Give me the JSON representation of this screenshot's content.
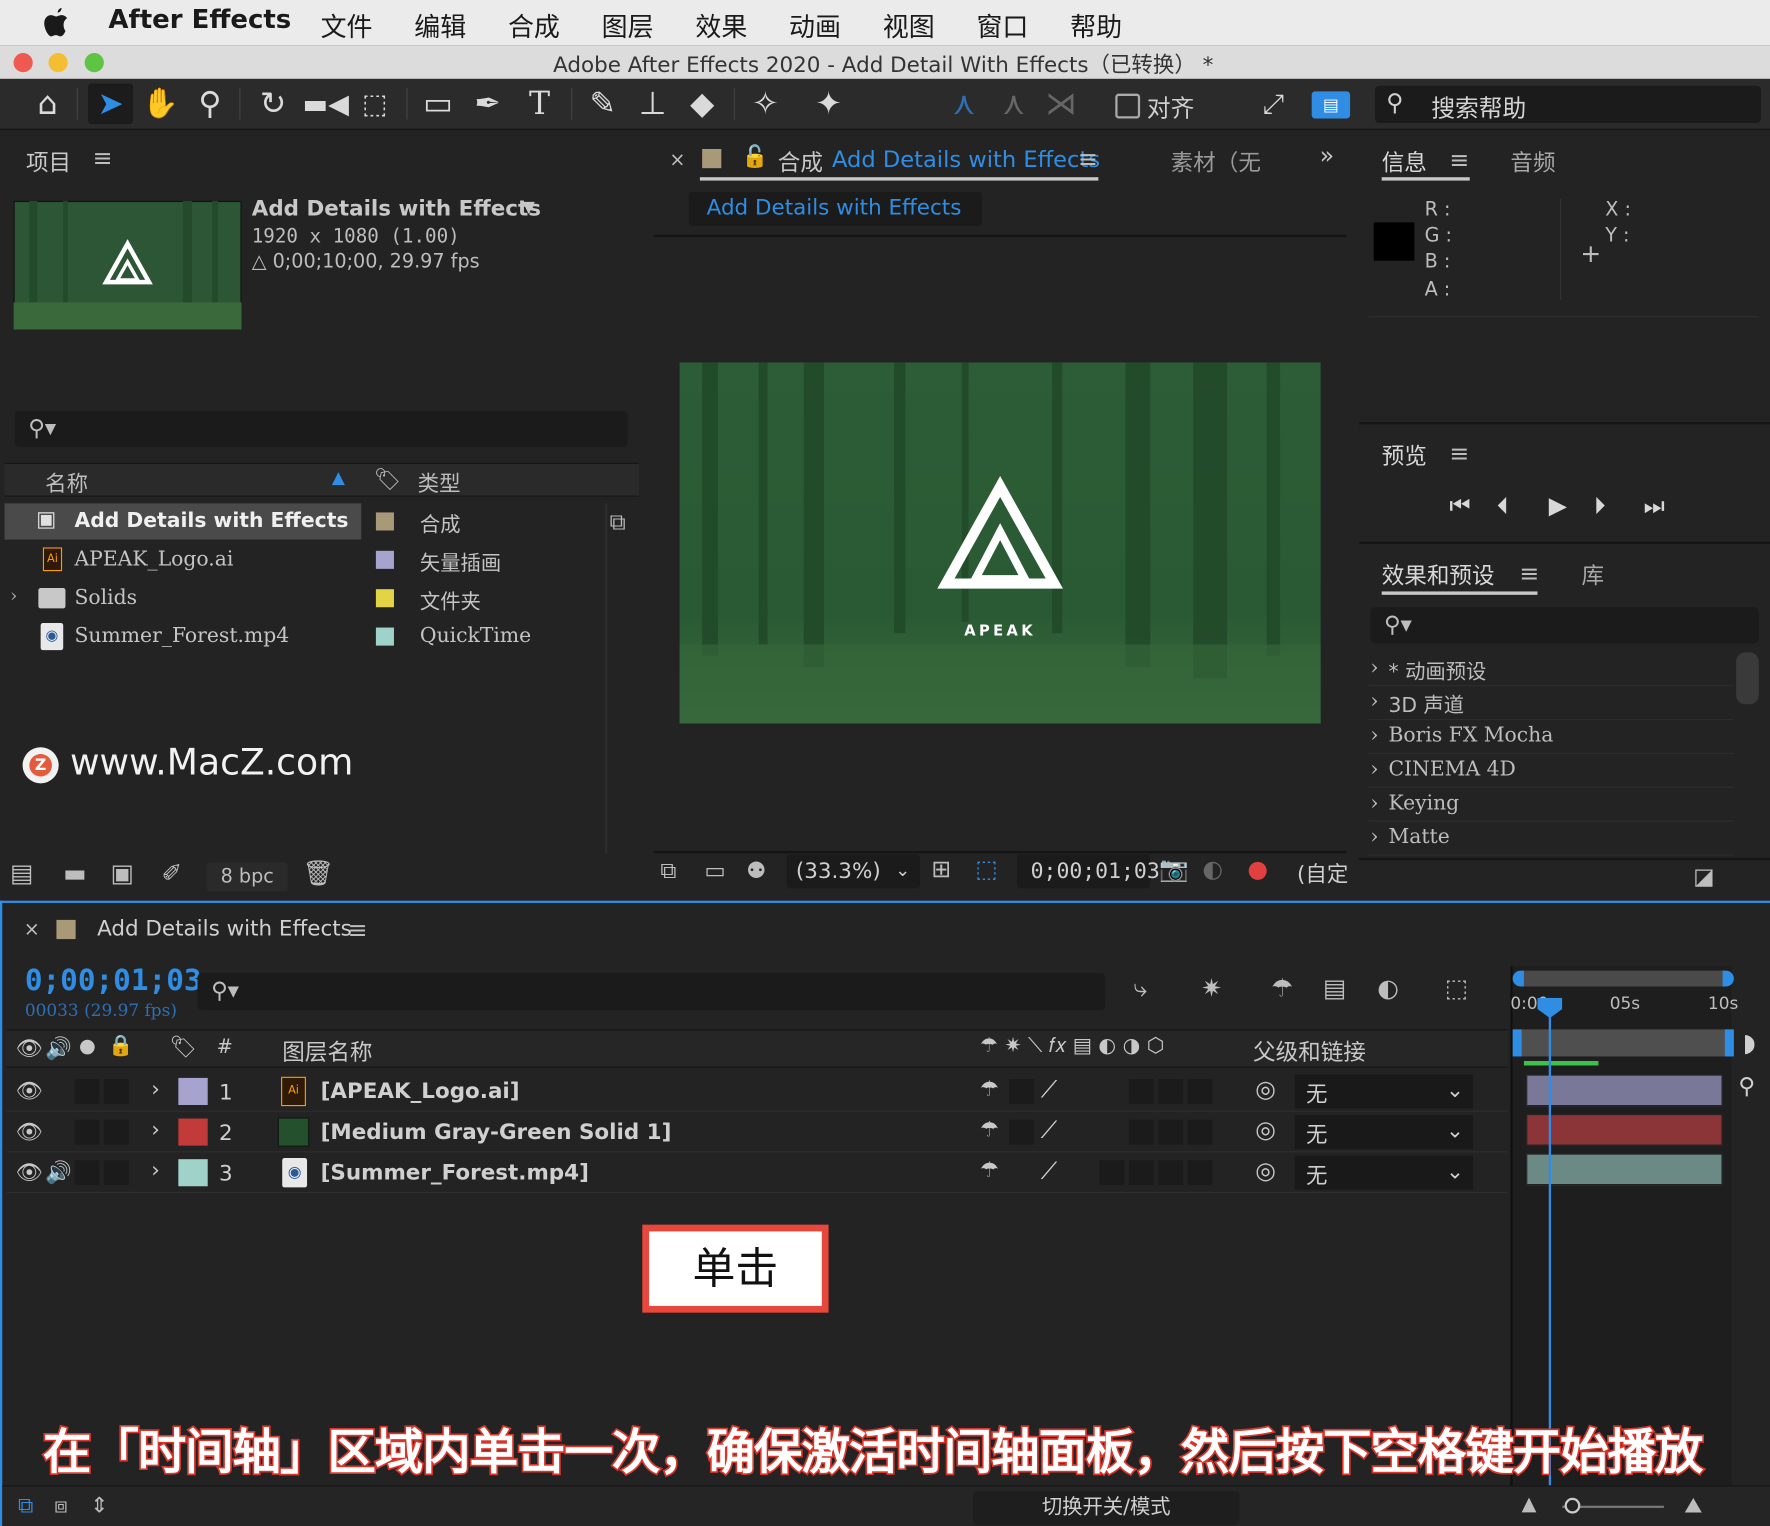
{
  "menubar": {
    "app_name": "After Effects",
    "items": [
      "文件",
      "编辑",
      "合成",
      "图层",
      "效果",
      "动画",
      "视图",
      "窗口",
      "帮助"
    ]
  },
  "window": {
    "title": "Adobe After Effects 2020 - Add Detail With Effects（已转换） *"
  },
  "toolbar": {
    "snap_label": "对齐",
    "search_placeholder": "搜索帮助"
  },
  "project": {
    "title": "项目",
    "selected": {
      "name": "Add Details with Effects",
      "resolution": "1920 x 1080 (1.00)",
      "duration": "△ 0;00;10;00, 29.97 fps"
    },
    "columns": {
      "name": "名称",
      "type": "类型"
    },
    "items": [
      {
        "name": "Add Details with Effects",
        "type": "合成",
        "color": "#a89a78"
      },
      {
        "name": "APEAK_Logo.ai",
        "type": "矢量插画",
        "color": "#a6a4cf"
      },
      {
        "name": "Solids",
        "type": "文件夹",
        "color": "#e3d446"
      },
      {
        "name": "Summer_Forest.mp4",
        "type": "QuickTime",
        "color": "#9fd3c9"
      }
    ],
    "bpc": "8 bpc",
    "watermark": "www.MacZ.com"
  },
  "composition": {
    "tab_prefix": "合成",
    "tab_name": "Add Details with Effects",
    "footage_tab": "素材（无",
    "breadcrumb": "Add Details with Effects",
    "logo_text": "APEAK",
    "zoom": "(33.3%)",
    "timecode": "0;00;01;03",
    "view_label": "(自定"
  },
  "info": {
    "title": "信息",
    "audio_tab": "音频",
    "r": "R :",
    "g": "G :",
    "b": "B :",
    "a": "A :",
    "x": "X :",
    "y": "Y :"
  },
  "preview": {
    "title": "预览"
  },
  "effects": {
    "title": "效果和预设",
    "library_tab": "库",
    "items": [
      "* 动画预设",
      "3D 声道",
      "Boris FX Mocha",
      "CINEMA 4D",
      "Keying",
      "Matte"
    ]
  },
  "timeline": {
    "tab": "Add Details with Effects",
    "timecode": "0;00;01;03",
    "frames": "00033 (29.97 fps)",
    "ruler": {
      "start": "0:00",
      "mid": "05s",
      "end": "10s"
    },
    "columns": {
      "number": "#",
      "layer_name": "图层名称",
      "parent": "父级和链接"
    },
    "layers": [
      {
        "num": "1",
        "name": "[APEAK_Logo.ai]",
        "color": "#a6a4cf",
        "parent": "无",
        "bar": "#7a7898"
      },
      {
        "num": "2",
        "name": "[Medium Gray-Green Solid 1]",
        "color": "#c23a3a",
        "parent": "无",
        "bar": "#8b3538"
      },
      {
        "num": "3",
        "name": "[Summer_Forest.mp4]",
        "color": "#9fd3c9",
        "parent": "无",
        "bar": "#6c8a85"
      }
    ],
    "toggle_label": "切换开关/模式"
  },
  "annotations": {
    "click_label": "单击",
    "caption": "在「时间轴」区域内单击一次，确保激活时间轴面板，然后按下空格键开始播放"
  }
}
